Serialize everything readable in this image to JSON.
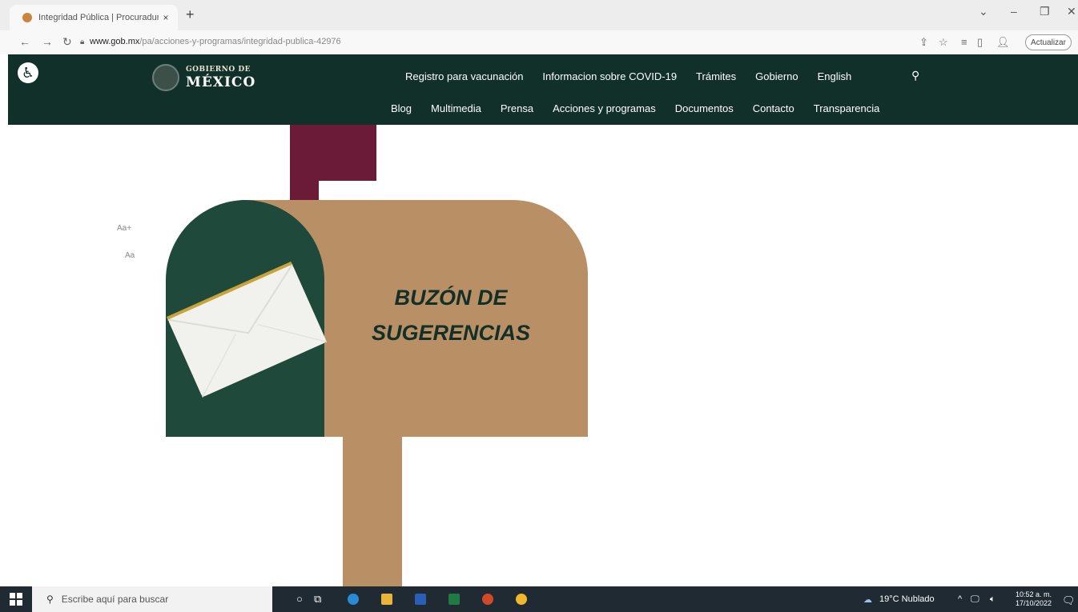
{
  "browser": {
    "tab_title": "Integridad Pública | Procuradur",
    "tab_close": "×",
    "new_tab": "+",
    "url_host": "www.gob.mx",
    "url_path": "/pa/acciones-y-programas/integridad-publica-42976",
    "update_label": "Actualizar"
  },
  "header": {
    "logo_line1": "GOBIERNO DE",
    "logo_line2": "MÉXICO",
    "nav_top": [
      "Registro para vacunación",
      "Informacion sobre COVID-19",
      "Trámites",
      "Gobierno",
      "English"
    ],
    "nav_bottom": [
      "Blog",
      "Multimedia",
      "Prensa",
      "Acciones y programas",
      "Documentos",
      "Contacto",
      "Transparencia"
    ]
  },
  "page": {
    "font_increase": "Aa+",
    "font_decrease": "Aa",
    "banner_line1": "BUZÓN DE",
    "banner_line2": "SUGERENCIAS"
  },
  "taskbar": {
    "search_placeholder": "Escribe aquí para buscar",
    "weather": "19°C Nublado",
    "time": "10:52 a. m.",
    "date": "17/10/2022"
  },
  "colors": {
    "header_bg": "#12302a",
    "mailbox_tan": "#b98f66",
    "mailbox_green": "#1f4a3b",
    "flag_maroon": "#6b1a38"
  }
}
